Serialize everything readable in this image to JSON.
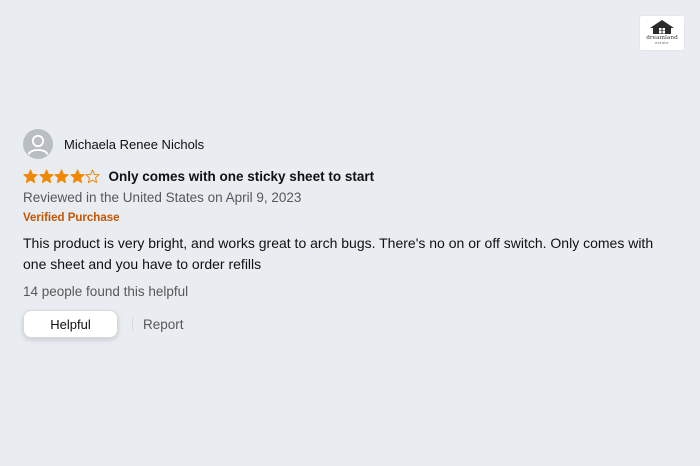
{
  "logo": {
    "name": "dreamland",
    "sub": "estate"
  },
  "review": {
    "reviewer": "Michaela Renee Nichols",
    "rating": 4,
    "max_rating": 5,
    "title": "Only comes with one sticky sheet to start",
    "date": "Reviewed in the United States on April 9, 2023",
    "badge": "Verified Purchase",
    "body": "This product is very bright, and works great to arch bugs. There's no on or off switch. Only comes with one sheet and you have to order refills",
    "helpful_count": "14 people found this helpful",
    "helpful_label": "Helpful",
    "report_label": "Report"
  },
  "colors": {
    "background": "#e9ecf1",
    "star": "#f08804",
    "verified": "#c45500",
    "muted": "#565959"
  }
}
